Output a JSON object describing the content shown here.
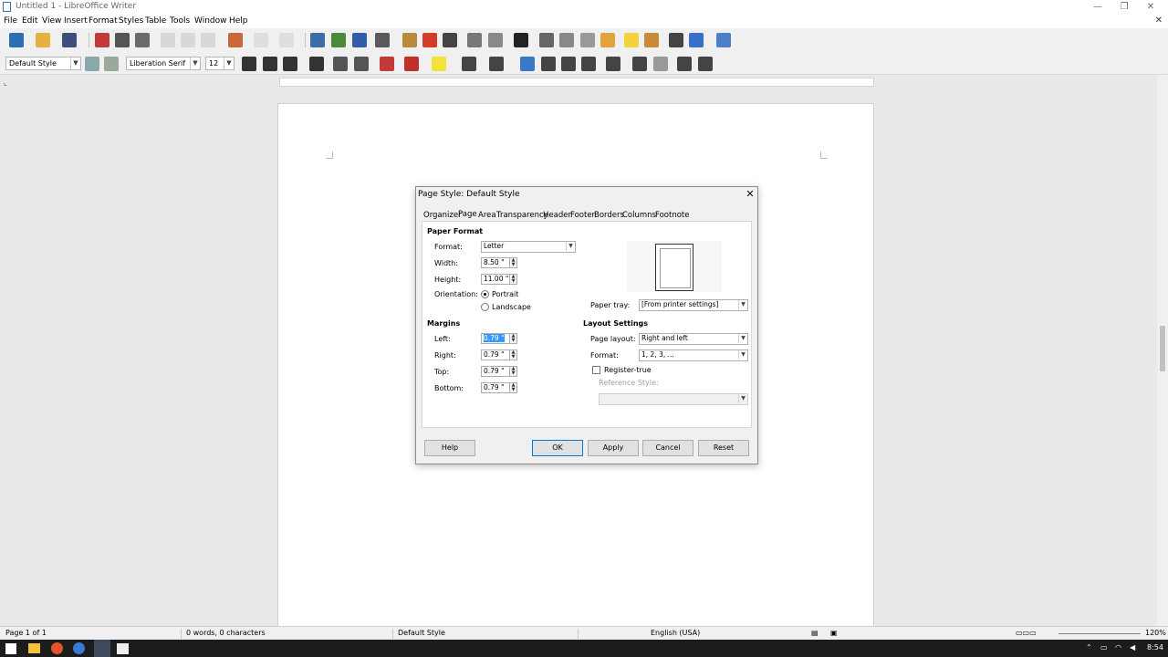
{
  "window": {
    "title": "Untitled 1 - LibreOffice Writer",
    "controls": {
      "minimize": "—",
      "restore": "❐",
      "close": "✕"
    }
  },
  "menubar": {
    "items": [
      "File",
      "Edit",
      "View",
      "Insert",
      "Format",
      "Styles",
      "Table",
      "Tools",
      "Window",
      "Help"
    ],
    "close_doc": "✕"
  },
  "toolbar2": {
    "paragraph_style": "Default Style",
    "font_name": "Liberation Serif",
    "font_size": "12"
  },
  "colors": {
    "accent": "#0078d7",
    "selection": "#3399ff",
    "taskbar": "#1c1c1c"
  },
  "dialog": {
    "title": "Page Style: Default Style",
    "close": "✕",
    "tabs": [
      "Organizer",
      "Page",
      "Area",
      "Transparency",
      "Header",
      "Footer",
      "Borders",
      "Columns",
      "Footnote"
    ],
    "active_tab": "Page",
    "paper_format": {
      "heading": "Paper Format",
      "format_label": "Format:",
      "format_value": "Letter",
      "width_label": "Width:",
      "width_value": "8.50 \"",
      "height_label": "Height:",
      "height_value": "11.00 \"",
      "orientation_label": "Orientation:",
      "portrait": "Portrait",
      "landscape": "Landscape",
      "orientation_selected": "Portrait",
      "paper_tray_label": "Paper tray:",
      "paper_tray_value": "[From printer settings]"
    },
    "margins": {
      "heading": "Margins",
      "left_label": "Left:",
      "left_value": "0.79 \"",
      "right_label": "Right:",
      "right_value": "0.79 \"",
      "top_label": "Top:",
      "top_value": "0.79 \"",
      "bottom_label": "Bottom:",
      "bottom_value": "0.79 \""
    },
    "layout_settings": {
      "heading": "Layout Settings",
      "page_layout_label": "Page layout:",
      "page_layout_value": "Right and left",
      "format_label": "Format:",
      "format_value": "1, 2, 3, ...",
      "register_true_label": "Register-true",
      "register_true_checked": false,
      "reference_style_label": "Reference Style:"
    },
    "buttons": {
      "help": "Help",
      "ok": "OK",
      "apply": "Apply",
      "cancel": "Cancel",
      "reset": "Reset"
    }
  },
  "statusbar": {
    "page": "Page 1 of 1",
    "words": "0 words, 0 characters",
    "style": "Default Style",
    "language": "English (USA)",
    "zoom": "120%"
  },
  "taskbar": {
    "clock": "8:54"
  }
}
